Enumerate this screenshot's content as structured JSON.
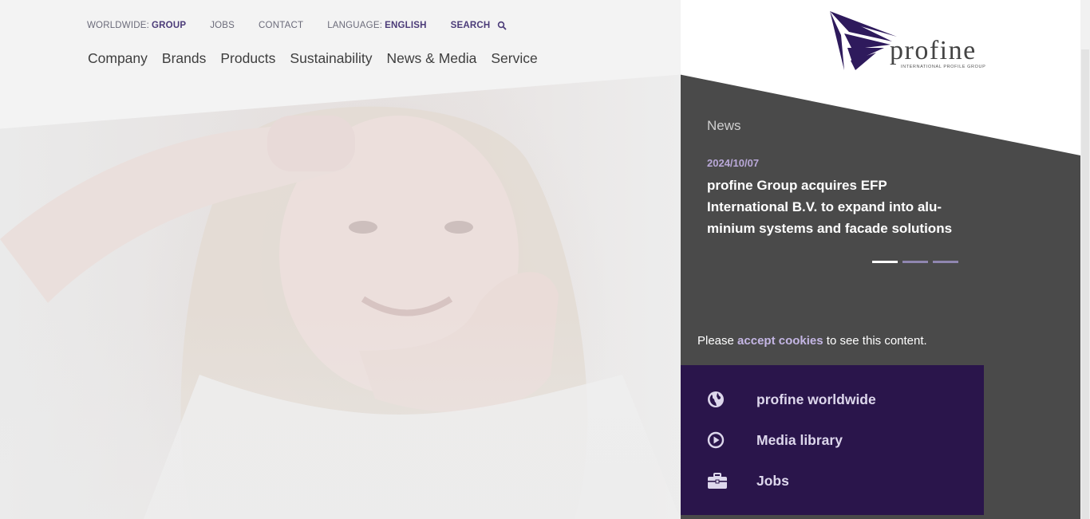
{
  "utility_nav": {
    "worldwide_prefix": "WORLDWIDE:",
    "worldwide_value": "GROUP",
    "jobs": "JOBS",
    "contact": "CONTACT",
    "language_prefix": "LANGUAGE:",
    "language_value": "ENGLISH",
    "search": "SEARCH",
    "search_icon": "magnifier-icon"
  },
  "main_nav": [
    "Company",
    "Brands",
    "Products",
    "Sustainability",
    "News & Media",
    "Service"
  ],
  "logo": {
    "wordmark": "profine",
    "tagline": "INTERNATIONAL PROFILE GROUP",
    "brand_color": "#2e1a5c"
  },
  "news": {
    "section_label": "News",
    "date": "2024/10/07",
    "headline_lines": [
      "profine Group acquires EFP",
      "International B.V. to expand into alu-",
      "minium systems and facade solutions"
    ],
    "slide_count": 3,
    "active_slide": 1
  },
  "cookie_notice": {
    "before": "Please",
    "link": "accept cookies",
    "after": "to see this content."
  },
  "quick_links": [
    {
      "label": "profine worldwide",
      "icon": "globe-icon"
    },
    {
      "label": "Media library",
      "icon": "play-circle-icon"
    },
    {
      "label": "Jobs",
      "icon": "briefcase-icon"
    }
  ],
  "colors": {
    "accent": "#4b3b78",
    "dark_panel": "#4a4a4a",
    "quick_links_bg": "#2a154b",
    "news_date": "#b9a8d8"
  }
}
